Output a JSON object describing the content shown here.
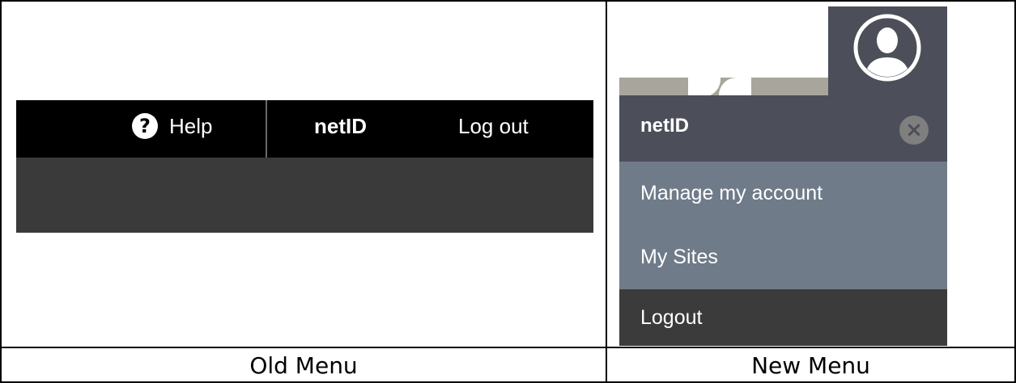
{
  "old_menu": {
    "caption": "Old Menu",
    "help_label": "Help",
    "help_icon": "?",
    "netid_label": "netID",
    "logout_label": "Log out"
  },
  "new_menu": {
    "caption": "New Menu",
    "netid_label": "netID",
    "close_icon": "×",
    "items": [
      {
        "label": "Manage my account"
      },
      {
        "label": "My Sites"
      },
      {
        "label": "Logout"
      }
    ]
  }
}
